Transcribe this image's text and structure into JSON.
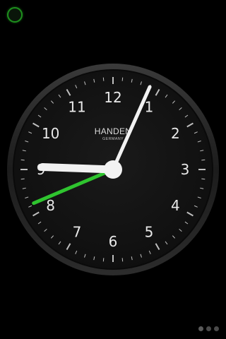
{
  "clock": {
    "brand": "HANDEN",
    "brand_sub": "GERMANY",
    "numerals": [
      "12",
      "1",
      "2",
      "3",
      "4",
      "5",
      "6",
      "7",
      "8",
      "9",
      "10",
      "11"
    ],
    "time": {
      "hour": 9,
      "minute": 4,
      "second": 0
    },
    "alarm_time": {
      "hour": 8,
      "minute": 0
    },
    "colors": {
      "face": "#111111",
      "bezel": "#2a2a2a",
      "ticks": "#bfbfbf",
      "numerals": "#e9e9e9",
      "hands": "#f2f2f2",
      "alarm_hand": "#2fc42f",
      "status_ring": "#1e8f1e"
    }
  },
  "pager": {
    "count": 3,
    "active_index": 0
  }
}
